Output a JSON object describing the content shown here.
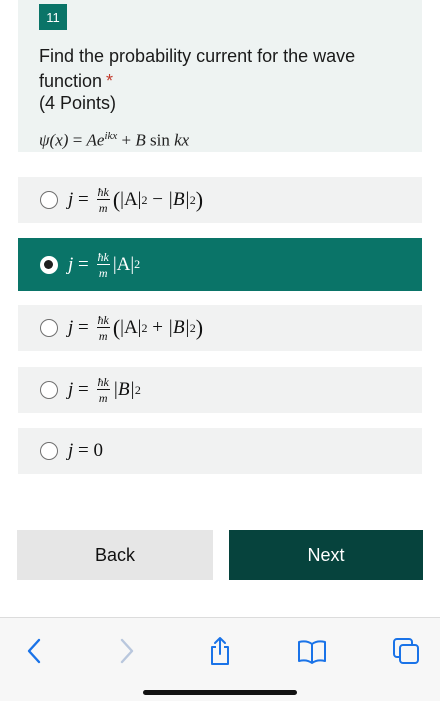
{
  "question": {
    "number": "11",
    "title": "Find the probability current for the wave function",
    "required_mark": "*",
    "points": "(4 Points)",
    "formula": {
      "lhs": "ψ(x)",
      "eq": "=",
      "a": "Ae",
      "a_exp": "ikx",
      "plus": "+",
      "b": "B",
      "sin": "sin",
      "kx": "kx"
    }
  },
  "options": [
    {
      "j": "j",
      "eq": "=",
      "num": "ħk",
      "den": "m",
      "open": "(",
      "t1": "|A|",
      "e1": "2",
      "op": "−",
      "t2": "|B|",
      "e2": "2",
      "close": ")",
      "selected": false
    },
    {
      "j": "j",
      "eq": "=",
      "num": "ħk",
      "den": "m",
      "t1": "|A|",
      "e1": "2",
      "selected": true
    },
    {
      "j": "j",
      "eq": "=",
      "num": "ħk",
      "den": "m",
      "open": "(",
      "t1": "|A|",
      "e1": "2",
      "op": "+",
      "t2": "|B|",
      "e2": "2",
      "close": ")",
      "selected": false
    },
    {
      "j": "j",
      "eq": "=",
      "num": "ħk",
      "den": "m",
      "t1": "|B|",
      "e1": "2",
      "selected": false
    },
    {
      "j": "j",
      "eq": "=",
      "val": "0",
      "selected": false
    }
  ],
  "buttons": {
    "back": "Back",
    "next": "Next"
  },
  "browser_toolbar": {
    "icons": [
      "back-chevron-icon",
      "forward-chevron-icon",
      "share-icon",
      "bookmarks-icon",
      "tabs-icon"
    ],
    "accent": "#1a73e8",
    "disabled": "#b9c7dd"
  },
  "colors": {
    "accent": "#0a7468",
    "next_button": "#06433d",
    "required": "#c23a2c"
  }
}
